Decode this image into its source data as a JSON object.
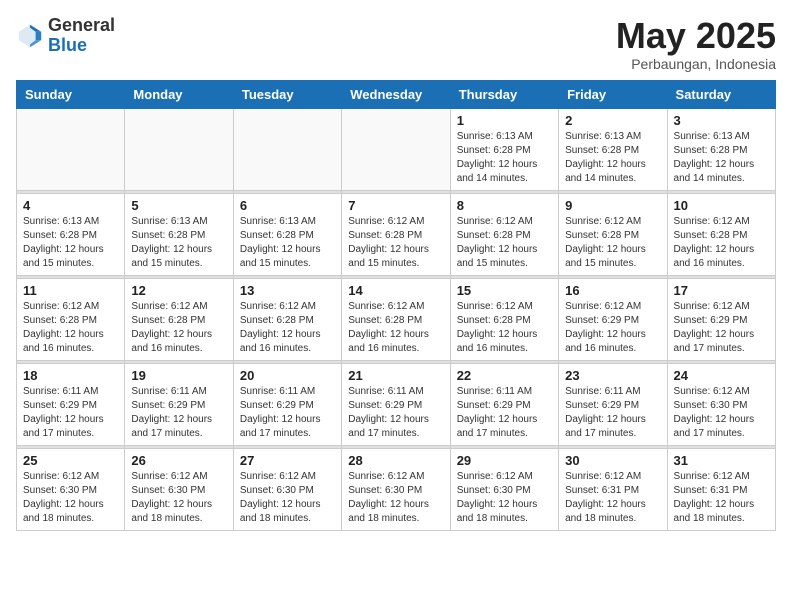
{
  "header": {
    "logo_general": "General",
    "logo_blue": "Blue",
    "month_title": "May 2025",
    "location": "Perbaungan, Indonesia"
  },
  "weekdays": [
    "Sunday",
    "Monday",
    "Tuesday",
    "Wednesday",
    "Thursday",
    "Friday",
    "Saturday"
  ],
  "weeks": [
    [
      {
        "day": "",
        "info": ""
      },
      {
        "day": "",
        "info": ""
      },
      {
        "day": "",
        "info": ""
      },
      {
        "day": "",
        "info": ""
      },
      {
        "day": "1",
        "info": "Sunrise: 6:13 AM\nSunset: 6:28 PM\nDaylight: 12 hours\nand 14 minutes."
      },
      {
        "day": "2",
        "info": "Sunrise: 6:13 AM\nSunset: 6:28 PM\nDaylight: 12 hours\nand 14 minutes."
      },
      {
        "day": "3",
        "info": "Sunrise: 6:13 AM\nSunset: 6:28 PM\nDaylight: 12 hours\nand 14 minutes."
      }
    ],
    [
      {
        "day": "4",
        "info": "Sunrise: 6:13 AM\nSunset: 6:28 PM\nDaylight: 12 hours\nand 15 minutes."
      },
      {
        "day": "5",
        "info": "Sunrise: 6:13 AM\nSunset: 6:28 PM\nDaylight: 12 hours\nand 15 minutes."
      },
      {
        "day": "6",
        "info": "Sunrise: 6:13 AM\nSunset: 6:28 PM\nDaylight: 12 hours\nand 15 minutes."
      },
      {
        "day": "7",
        "info": "Sunrise: 6:12 AM\nSunset: 6:28 PM\nDaylight: 12 hours\nand 15 minutes."
      },
      {
        "day": "8",
        "info": "Sunrise: 6:12 AM\nSunset: 6:28 PM\nDaylight: 12 hours\nand 15 minutes."
      },
      {
        "day": "9",
        "info": "Sunrise: 6:12 AM\nSunset: 6:28 PM\nDaylight: 12 hours\nand 15 minutes."
      },
      {
        "day": "10",
        "info": "Sunrise: 6:12 AM\nSunset: 6:28 PM\nDaylight: 12 hours\nand 16 minutes."
      }
    ],
    [
      {
        "day": "11",
        "info": "Sunrise: 6:12 AM\nSunset: 6:28 PM\nDaylight: 12 hours\nand 16 minutes."
      },
      {
        "day": "12",
        "info": "Sunrise: 6:12 AM\nSunset: 6:28 PM\nDaylight: 12 hours\nand 16 minutes."
      },
      {
        "day": "13",
        "info": "Sunrise: 6:12 AM\nSunset: 6:28 PM\nDaylight: 12 hours\nand 16 minutes."
      },
      {
        "day": "14",
        "info": "Sunrise: 6:12 AM\nSunset: 6:28 PM\nDaylight: 12 hours\nand 16 minutes."
      },
      {
        "day": "15",
        "info": "Sunrise: 6:12 AM\nSunset: 6:28 PM\nDaylight: 12 hours\nand 16 minutes."
      },
      {
        "day": "16",
        "info": "Sunrise: 6:12 AM\nSunset: 6:29 PM\nDaylight: 12 hours\nand 16 minutes."
      },
      {
        "day": "17",
        "info": "Sunrise: 6:12 AM\nSunset: 6:29 PM\nDaylight: 12 hours\nand 17 minutes."
      }
    ],
    [
      {
        "day": "18",
        "info": "Sunrise: 6:11 AM\nSunset: 6:29 PM\nDaylight: 12 hours\nand 17 minutes."
      },
      {
        "day": "19",
        "info": "Sunrise: 6:11 AM\nSunset: 6:29 PM\nDaylight: 12 hours\nand 17 minutes."
      },
      {
        "day": "20",
        "info": "Sunrise: 6:11 AM\nSunset: 6:29 PM\nDaylight: 12 hours\nand 17 minutes."
      },
      {
        "day": "21",
        "info": "Sunrise: 6:11 AM\nSunset: 6:29 PM\nDaylight: 12 hours\nand 17 minutes."
      },
      {
        "day": "22",
        "info": "Sunrise: 6:11 AM\nSunset: 6:29 PM\nDaylight: 12 hours\nand 17 minutes."
      },
      {
        "day": "23",
        "info": "Sunrise: 6:11 AM\nSunset: 6:29 PM\nDaylight: 12 hours\nand 17 minutes."
      },
      {
        "day": "24",
        "info": "Sunrise: 6:12 AM\nSunset: 6:30 PM\nDaylight: 12 hours\nand 17 minutes."
      }
    ],
    [
      {
        "day": "25",
        "info": "Sunrise: 6:12 AM\nSunset: 6:30 PM\nDaylight: 12 hours\nand 18 minutes."
      },
      {
        "day": "26",
        "info": "Sunrise: 6:12 AM\nSunset: 6:30 PM\nDaylight: 12 hours\nand 18 minutes."
      },
      {
        "day": "27",
        "info": "Sunrise: 6:12 AM\nSunset: 6:30 PM\nDaylight: 12 hours\nand 18 minutes."
      },
      {
        "day": "28",
        "info": "Sunrise: 6:12 AM\nSunset: 6:30 PM\nDaylight: 12 hours\nand 18 minutes."
      },
      {
        "day": "29",
        "info": "Sunrise: 6:12 AM\nSunset: 6:30 PM\nDaylight: 12 hours\nand 18 minutes."
      },
      {
        "day": "30",
        "info": "Sunrise: 6:12 AM\nSunset: 6:31 PM\nDaylight: 12 hours\nand 18 minutes."
      },
      {
        "day": "31",
        "info": "Sunrise: 6:12 AM\nSunset: 6:31 PM\nDaylight: 12 hours\nand 18 minutes."
      }
    ]
  ]
}
